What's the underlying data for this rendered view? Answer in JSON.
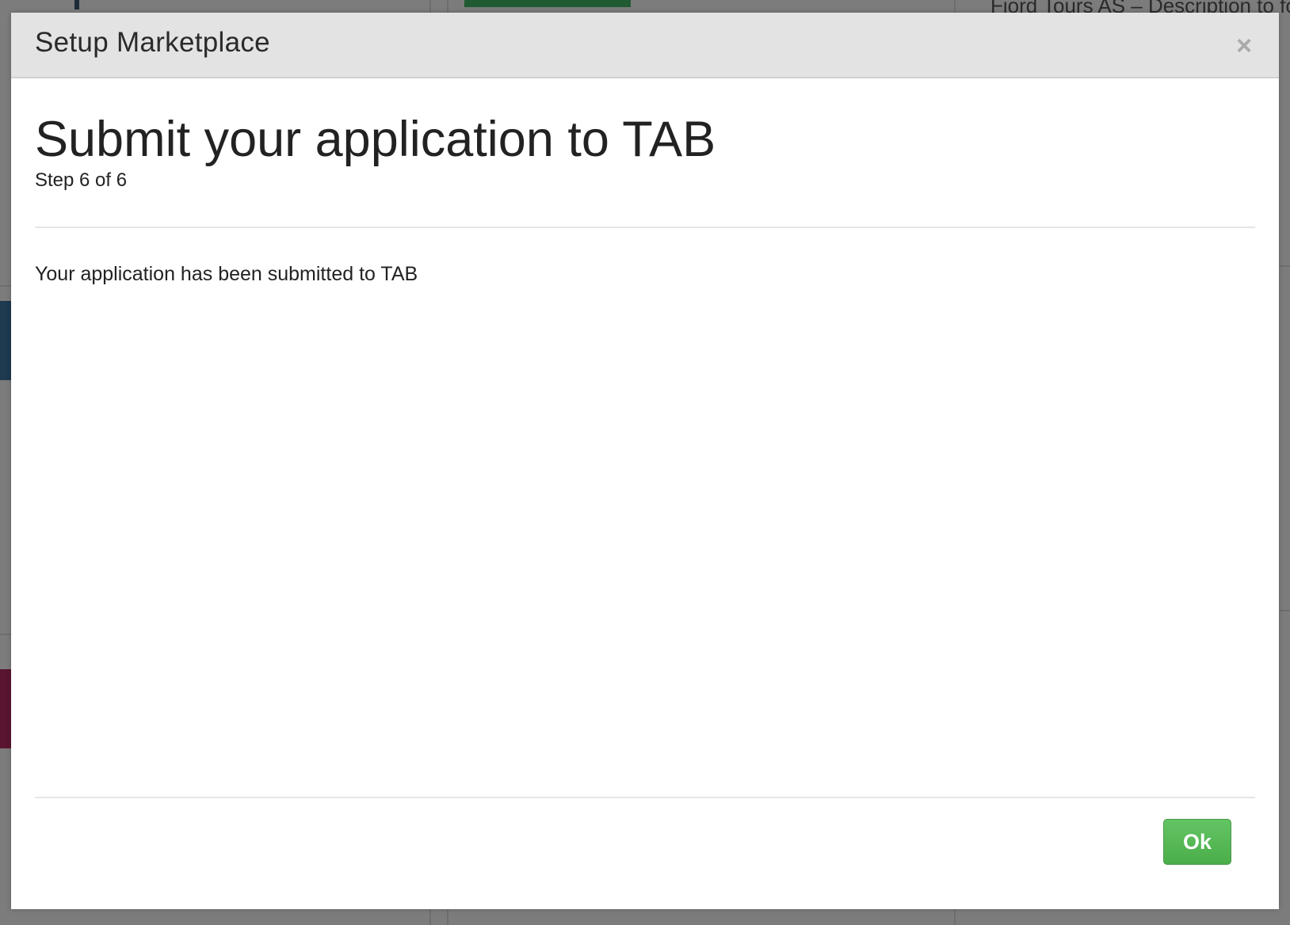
{
  "modal": {
    "title": "Setup Marketplace",
    "close_symbol": "×",
    "heading": "Submit your application to TAB",
    "step": "Step 6 of 6",
    "message": "Your application has been submitted to TAB",
    "ok_label": "Ok"
  },
  "background": {
    "partial_text": "Fjord Tours AS – Description to fo"
  },
  "colors": {
    "overlay": "#7c7c7c",
    "header_bg": "#e3e3e3",
    "ok_green": "#5cb85c",
    "close_gray": "#a9a9a9"
  },
  "icons": {
    "close": "close-icon"
  }
}
